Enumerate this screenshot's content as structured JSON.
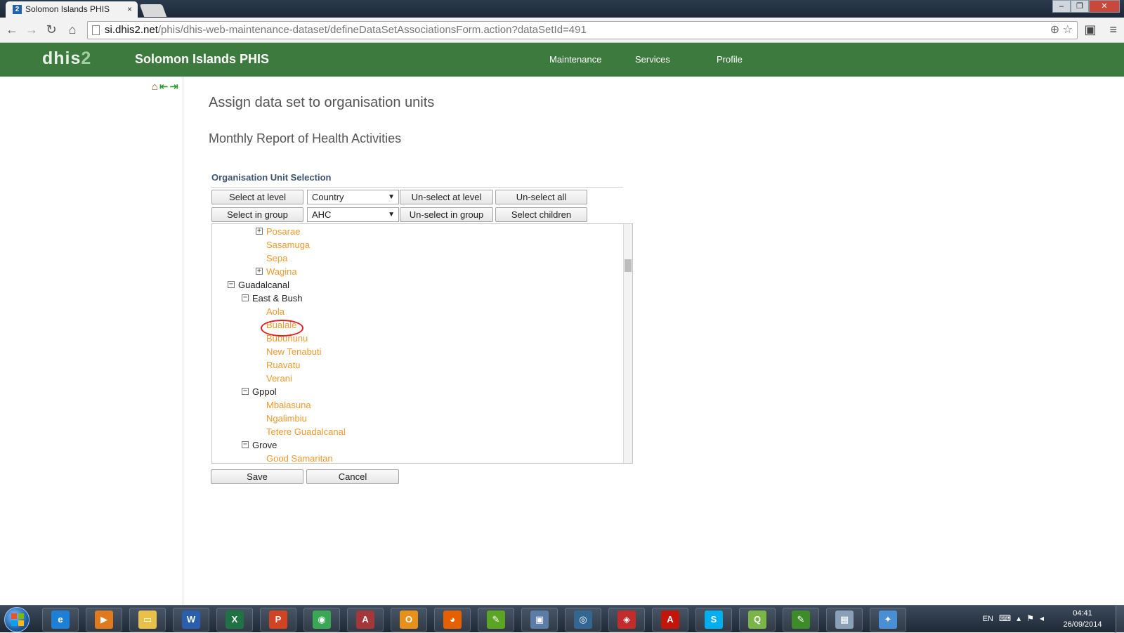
{
  "browser": {
    "tab_title": "Solomon Islands PHIS",
    "tab_favicon": "2",
    "tab_close": "×",
    "url_host": "si.dhis2.net",
    "url_path": "/phis/dhis-web-maintenance-dataset/defineDataSetAssociationsForm.action?dataSetId=491",
    "icons": {
      "back": "back-arrow-icon",
      "forward": "forward-arrow-icon",
      "reload": "reload-icon",
      "home": "home-icon",
      "zoom": "zoom-icon",
      "star": "star-icon",
      "extension": "extension-icon",
      "menu": "menu-icon"
    }
  },
  "header": {
    "logo_main": "dhis",
    "logo_num": "2",
    "app_title": "Solomon Islands PHIS",
    "menu": [
      "Maintenance",
      "Services",
      "Profile"
    ],
    "color": "#3c7a3e"
  },
  "sidebar": {
    "icons": [
      "home-icon",
      "back-arrow-icon",
      "forward-arrow-icon"
    ]
  },
  "main": {
    "title": "Assign data set to organisation units",
    "dataset_name": "Monthly Report of Health Activities",
    "section_title": "Organisation Unit Selection",
    "buttons": {
      "select_at_level": "Select at level",
      "unselect_at_level": "Un-select at level",
      "unselect_all": "Un-select all",
      "select_in_group": "Select in group",
      "unselect_in_group": "Un-select in group",
      "select_children": "Select children",
      "save": "Save",
      "cancel": "Cancel"
    },
    "level_select": "Country",
    "group_select": "AHC",
    "highlighted_unit": "Bualale",
    "highlight_color": "#e02020",
    "tree": [
      {
        "label": "Posarae",
        "depth": 2,
        "toggle": "+",
        "color": "orange"
      },
      {
        "label": "Sasamuga",
        "depth": 2,
        "toggle": "",
        "color": "orange"
      },
      {
        "label": "Sepa",
        "depth": 2,
        "toggle": "",
        "color": "orange"
      },
      {
        "label": "Wagina",
        "depth": 2,
        "toggle": "+",
        "color": "orange"
      },
      {
        "label": "Guadalcanal",
        "depth": 0,
        "toggle": "-",
        "color": "black"
      },
      {
        "label": "East & Bush",
        "depth": 1,
        "toggle": "-",
        "color": "black"
      },
      {
        "label": "Aola",
        "depth": 2,
        "toggle": "",
        "color": "orange"
      },
      {
        "label": "Bualale",
        "depth": 2,
        "toggle": "",
        "color": "orange"
      },
      {
        "label": "Bubununu",
        "depth": 2,
        "toggle": "",
        "color": "orange"
      },
      {
        "label": "New Tenabuti",
        "depth": 2,
        "toggle": "",
        "color": "orange"
      },
      {
        "label": "Ruavatu",
        "depth": 2,
        "toggle": "",
        "color": "orange"
      },
      {
        "label": "Verani",
        "depth": 2,
        "toggle": "",
        "color": "orange"
      },
      {
        "label": "Gppol",
        "depth": 1,
        "toggle": "-",
        "color": "black"
      },
      {
        "label": "Mbalasuna",
        "depth": 2,
        "toggle": "",
        "color": "orange"
      },
      {
        "label": "Ngalimbiu",
        "depth": 2,
        "toggle": "",
        "color": "orange"
      },
      {
        "label": "Tetere Guadalcanal",
        "depth": 2,
        "toggle": "",
        "color": "orange"
      },
      {
        "label": "Grove",
        "depth": 1,
        "toggle": "-",
        "color": "black"
      },
      {
        "label": "Good Samaritan",
        "depth": 2,
        "toggle": "",
        "color": "orange"
      }
    ]
  },
  "taskbar": {
    "apps": [
      {
        "name": "internet-explorer-icon",
        "glyph": "e",
        "color": "#1e7fd6"
      },
      {
        "name": "media-player-icon",
        "glyph": "▶",
        "color": "#e07a1e"
      },
      {
        "name": "file-explorer-icon",
        "glyph": "▭",
        "color": "#e8c14a"
      },
      {
        "name": "word-icon",
        "glyph": "W",
        "color": "#2b5fad"
      },
      {
        "name": "excel-icon",
        "glyph": "X",
        "color": "#207245"
      },
      {
        "name": "powerpoint-icon",
        "glyph": "P",
        "color": "#d04423"
      },
      {
        "name": "chrome-icon",
        "glyph": "◉",
        "color": "#3aa757"
      },
      {
        "name": "access-icon",
        "glyph": "A",
        "color": "#a4373a"
      },
      {
        "name": "outlook-icon",
        "glyph": "O",
        "color": "#e6911a"
      },
      {
        "name": "firefox-icon",
        "glyph": "◕",
        "color": "#e66000"
      },
      {
        "name": "evernote-icon",
        "glyph": "✎",
        "color": "#5ba525"
      },
      {
        "name": "remote-desktop-icon",
        "glyph": "▣",
        "color": "#5c7ca8"
      },
      {
        "name": "postgresql-icon",
        "glyph": "◎",
        "color": "#336791"
      },
      {
        "name": "security-icon",
        "glyph": "◈",
        "color": "#c42b2b"
      },
      {
        "name": "acrobat-icon",
        "glyph": "A",
        "color": "#c3150a"
      },
      {
        "name": "skype-icon",
        "glyph": "S",
        "color": "#00aff0"
      },
      {
        "name": "qgis-icon",
        "glyph": "Q",
        "color": "#7ab547"
      },
      {
        "name": "evernote-2-icon",
        "glyph": "✎",
        "color": "#3e8b2a"
      },
      {
        "name": "calculator-icon",
        "glyph": "▦",
        "color": "#8aa0b8"
      },
      {
        "name": "paint-icon",
        "glyph": "✦",
        "color": "#4a8fd4"
      }
    ],
    "lang": "EN",
    "time": "04:41",
    "date": "26/09/2014"
  }
}
